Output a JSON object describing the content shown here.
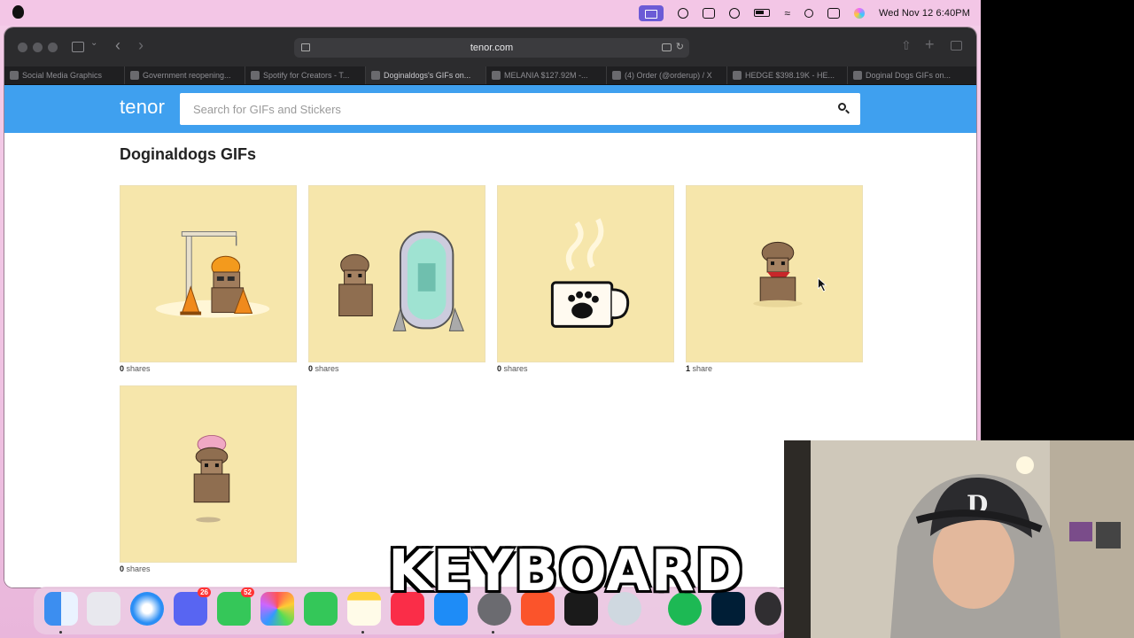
{
  "menubar": {
    "clock": "Wed Nov 12  6:40PM"
  },
  "browser": {
    "address": "tenor.com",
    "tabs": [
      {
        "label": "Social Media Graphics",
        "active": false
      },
      {
        "label": "Government reopening...",
        "active": false
      },
      {
        "label": "Spotify for Creators - T...",
        "active": false
      },
      {
        "label": "Doginaldogs's GIFs on...",
        "active": true
      },
      {
        "label": "MELANIA $127.92M -...",
        "active": false
      },
      {
        "label": "(4) Order (@orderup) / X",
        "active": false
      },
      {
        "label": "HEDGE $398.19K - HE...",
        "active": false
      },
      {
        "label": "Doginal Dogs GIFs on...",
        "active": false
      }
    ]
  },
  "tenor": {
    "logo": "tenor",
    "search": {
      "placeholder": "Search for GIFs and Stickers",
      "value": ""
    },
    "page_title": "Doginaldogs GIFs",
    "gifs": [
      {
        "subject": "construction-dog",
        "count": "0",
        "unit": "shares"
      },
      {
        "subject": "mirror-dog",
        "count": "0",
        "unit": "shares"
      },
      {
        "subject": "coffee-cup",
        "count": "0",
        "unit": "shares"
      },
      {
        "subject": "bandana-dog",
        "count": "1",
        "unit": "share"
      },
      {
        "subject": "brain-dog",
        "count": "0",
        "unit": "shares"
      }
    ]
  },
  "dock": {
    "apps": [
      "finder-icon",
      "launchpad-icon",
      "safari-icon",
      "discord-icon",
      "messages-icon",
      "photos-icon",
      "facetime-icon",
      "notes-icon",
      "music-icon",
      "app-store-icon",
      "system-settings-icon",
      "brave-icon",
      "capcut-icon",
      "quicktime-icon",
      "spotify-icon",
      "photoshop-icon",
      "obs-icon"
    ],
    "badges": {
      "discord": "26",
      "messages": "52"
    }
  },
  "caption": "KEYBOARD",
  "colors": {
    "tenor_blue": "#3fa0ef",
    "gif_bg": "#f6e6ab",
    "wallpaper": "#f3c6e6"
  }
}
